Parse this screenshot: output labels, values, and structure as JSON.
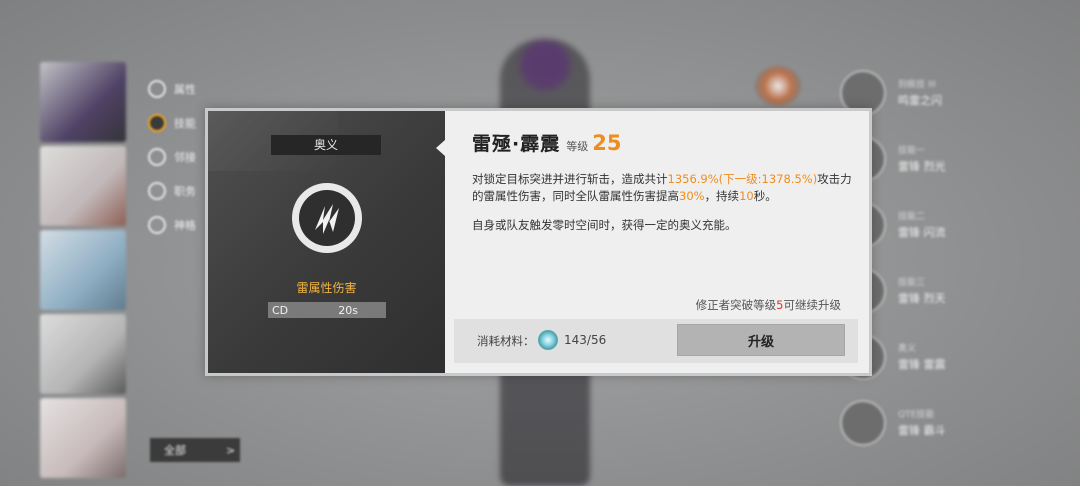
{
  "background": {
    "left_menu": [
      {
        "label": "属性",
        "active": false
      },
      {
        "label": "技能",
        "active": true
      },
      {
        "label": "邻接",
        "active": false
      },
      {
        "label": "职务",
        "active": false
      },
      {
        "label": "神格",
        "active": false
      }
    ],
    "all_button": {
      "label": "全部",
      "arrow": ">"
    },
    "right_list": [
      {
        "sub": "刻痕技 III",
        "title": "鸣雷之闪"
      },
      {
        "sub": "技能一",
        "title": "雷锋 烈光"
      },
      {
        "sub": "技能二",
        "title": "雷锋 闪流"
      },
      {
        "sub": "技能三",
        "title": "雷锋 烈天"
      },
      {
        "sub": "奥义",
        "title": "雷锋 雷震"
      },
      {
        "sub": "QTE技能",
        "title": "雷锋 霸斗"
      }
    ]
  },
  "modal": {
    "left": {
      "tag": "奥义",
      "icon": "lightning-slash-icon",
      "element": "雷属性伤害",
      "cd_label": "CD",
      "cd_value": "20s"
    },
    "skill_name": "雷殛·霹震",
    "level_label": "等级",
    "level_value": "25",
    "description": {
      "part1": "对锁定目标突进并进行斩击，造成共计",
      "value1": "1356.9%(下一级:1378.5%)",
      "part2": "攻击力的雷属性伤害，同时全队雷属性伤害提高",
      "value2": "30%",
      "part3": "，持续",
      "value3": "10",
      "part4": "秒。"
    },
    "description2": "自身或队友触发零时空间时，获得一定的奥义充能。",
    "note": {
      "part1": "修正者突破等级",
      "value": "5",
      "part2": "可继续升级"
    },
    "footer": {
      "material_label": "消耗材料：",
      "material_icon": "crystal-icon",
      "material_count": "143/56",
      "upgrade_label": "升级"
    }
  },
  "colors": {
    "accent_orange": "#f08d1a",
    "element_gold": "#f4b541",
    "warn_red": "#e0352b"
  }
}
